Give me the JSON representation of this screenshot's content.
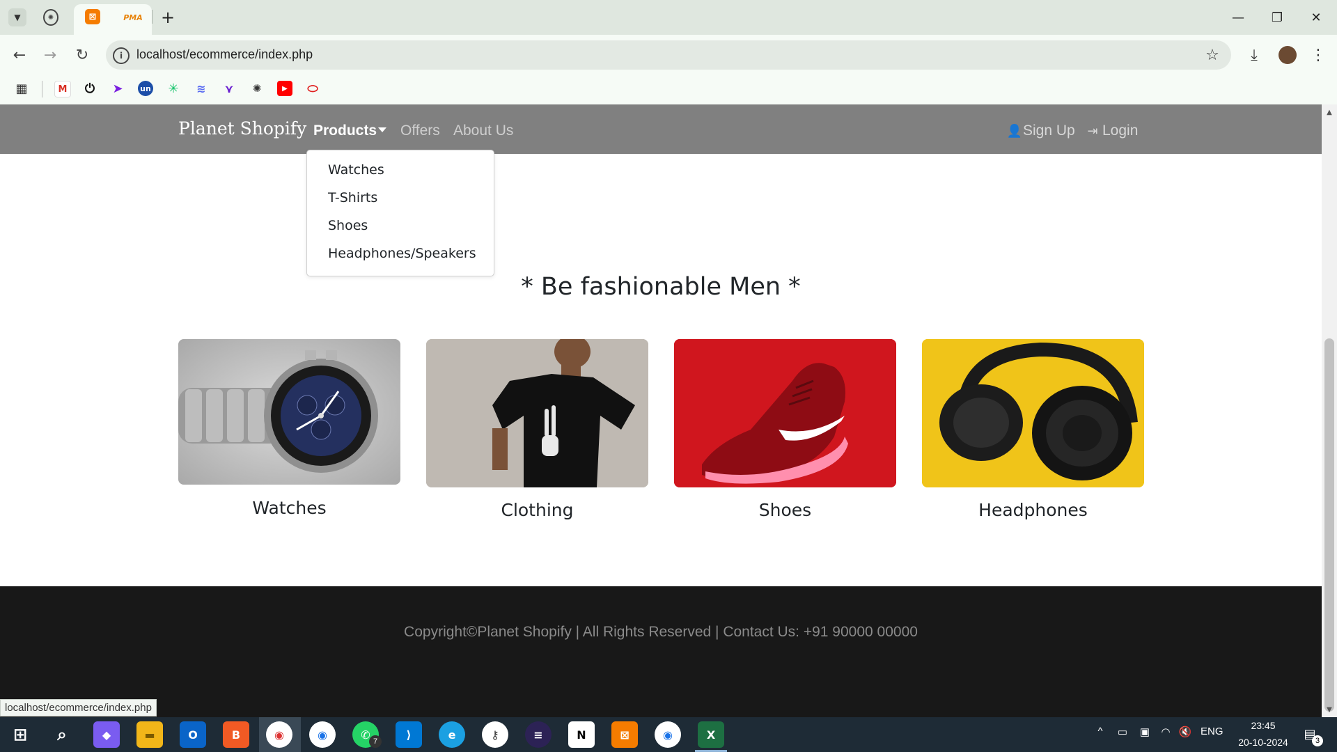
{
  "browser": {
    "url": "localhost/ecommerce/index.php",
    "status_url": "localhost/ecommerce/index.php",
    "tabs": [
      {
        "icon": "openai-icon"
      },
      {
        "icon": "xampp-icon",
        "active": true
      },
      {
        "icon": "phpmyadmin-icon"
      }
    ],
    "new_tab_label": "+",
    "bookmarks": [
      {
        "icon": "apps-grid-icon"
      },
      {
        "icon": "gmail-icon"
      },
      {
        "icon": "power-icon"
      },
      {
        "icon": "arrow-icon"
      },
      {
        "icon": "unstop-icon"
      },
      {
        "icon": "sparkle-icon"
      },
      {
        "icon": "stripes-icon"
      },
      {
        "icon": "bird-icon"
      },
      {
        "icon": "openai-icon"
      },
      {
        "icon": "youtube-icon"
      },
      {
        "icon": "oracle-icon"
      }
    ]
  },
  "site": {
    "brand": "Planet Shopify",
    "nav": {
      "products": "Products",
      "offers": "Offers",
      "about": "About Us",
      "signup": "Sign Up",
      "login": "Login"
    },
    "dropdown": [
      "Watches",
      "T-Shirts",
      "Shoes",
      "Headphones/Speakers"
    ],
    "headline": "* Be fashionable Men *",
    "cards": [
      {
        "caption": "Watches",
        "image": "watch-image"
      },
      {
        "caption": "Clothing",
        "image": "tshirt-image"
      },
      {
        "caption": "Shoes",
        "image": "shoe-image"
      },
      {
        "caption": "Headphones",
        "image": "headphones-image"
      }
    ],
    "footer": "Copyright©Planet Shopify | All Rights Reserved | Contact Us: +91 90000 00000"
  },
  "taskbar": {
    "whatsapp_badge": "7",
    "lang": "ENG",
    "time": "23:45",
    "date": "20-10-2024",
    "notifications": "3"
  },
  "colors": {
    "navbar": "#808080",
    "footer": "#181818",
    "taskbar": "#1e2b36"
  }
}
